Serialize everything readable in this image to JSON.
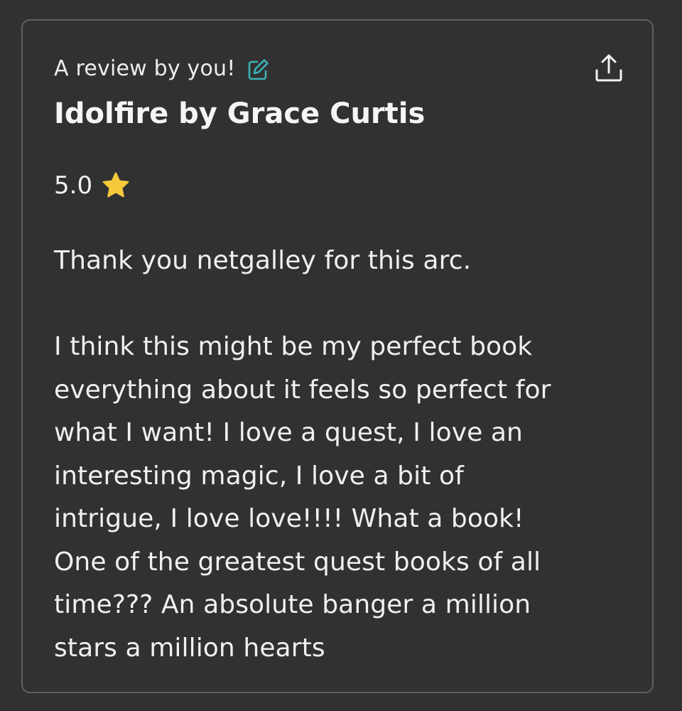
{
  "review_card": {
    "subtitle": "A review by you!",
    "book_title": "Idolfire by Grace Curtis",
    "rating": "5.0",
    "paragraphs": [
      "Thank you netgalley for this arc.",
      "I think this might be my perfect book\neverything about it feels so perfect for\nwhat I want! I love a quest, I love an\ninteresting magic, I love a bit of\nintrigue, I love love!!!! What a book!\nOne of the greatest quest books of all\ntime??? An absolute banger a million\nstars a million hearts"
    ],
    "icons": {
      "edit": "edit-icon",
      "share": "share-icon",
      "star": "star-icon"
    },
    "colors": {
      "background": "#313131",
      "border": "#5f5f5f",
      "edit_accent": "#3bb3b8",
      "star": "#f5c93a"
    }
  }
}
